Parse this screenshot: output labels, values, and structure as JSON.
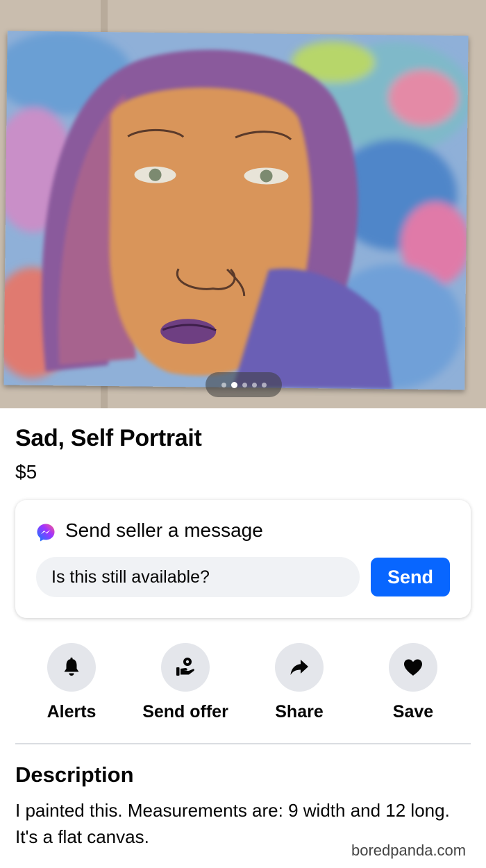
{
  "listing": {
    "title": "Sad, Self Portrait",
    "price": "$5",
    "photo_count": 5,
    "active_photo_index": 1
  },
  "message": {
    "heading": "Send seller a message",
    "input_value": "Is this still available?",
    "send_label": "Send"
  },
  "actions": [
    {
      "label": "Alerts",
      "icon": "bell-icon"
    },
    {
      "label": "Send offer",
      "icon": "offer-hand-icon"
    },
    {
      "label": "Share",
      "icon": "share-arrow-icon"
    },
    {
      "label": "Save",
      "icon": "heart-icon"
    }
  ],
  "description": {
    "heading": "Description",
    "text": "I painted this. Measurements are: 9 width and 12 long. It's a flat canvas."
  },
  "watermark": "boredpanda.com",
  "colors": {
    "accent": "#0866ff",
    "action_circle": "#e4e6eb",
    "input_bg": "#f0f2f5"
  }
}
